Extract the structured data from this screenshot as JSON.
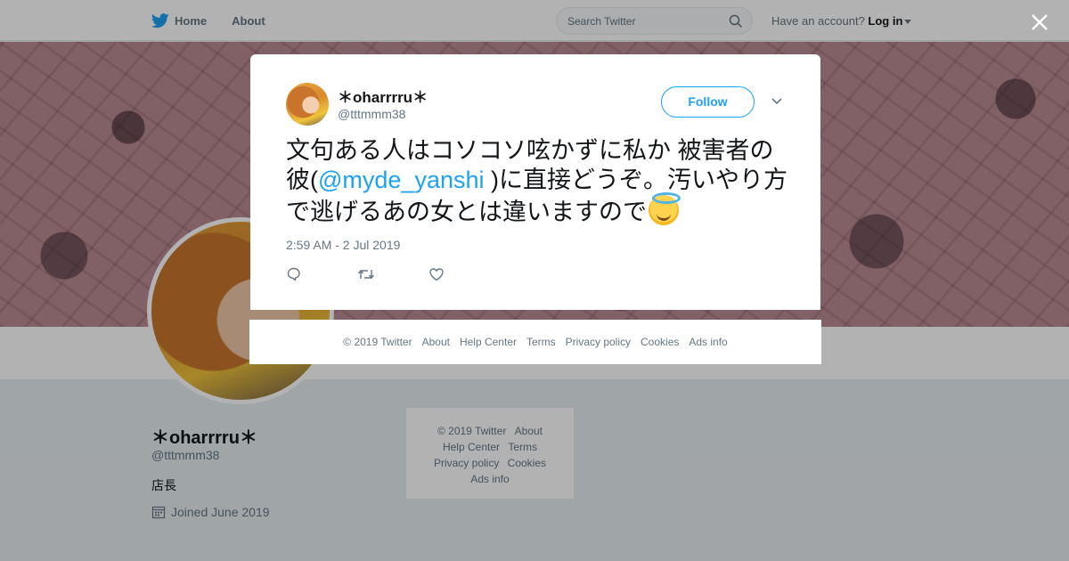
{
  "nav": {
    "home_label": "Home",
    "about_label": "About",
    "search_placeholder": "Search Twitter",
    "account_prompt": "Have an account?",
    "login_label": "Log in"
  },
  "profile": {
    "name": "＊oharrrru＊",
    "handle": "@tttmmm38",
    "bio": "店長",
    "joined": "Joined June 2019"
  },
  "side_footer": {
    "copyright": "© 2019 Twitter",
    "about": "About",
    "help_center": "Help Center",
    "terms": "Terms",
    "privacy": "Privacy policy",
    "cookies": "Cookies",
    "ads_info": "Ads info"
  },
  "tweet": {
    "author_name": "＊oharrrru＊",
    "author_handle": "@tttmmm38",
    "follow_label": "Follow",
    "text_part1": "文句ある人はコソコソ呟かずに私か 被害者の彼(",
    "mention": "@myde_yanshi",
    "text_part2": " )に直接どうぞ。汚いやり方で逃げるあの女とは違いますので",
    "emoji": "smiling-face-with-halo",
    "timestamp": "2:59 AM - 2 Jul 2019"
  },
  "footer": {
    "copyright": "© 2019 Twitter",
    "about": "About",
    "help_center": "Help Center",
    "terms": "Terms",
    "privacy": "Privacy policy",
    "cookies": "Cookies",
    "ads_info": "Ads info"
  },
  "colors": {
    "brand": "#1da1f2",
    "overlay": "rgba(0,0,0,0.3)"
  }
}
